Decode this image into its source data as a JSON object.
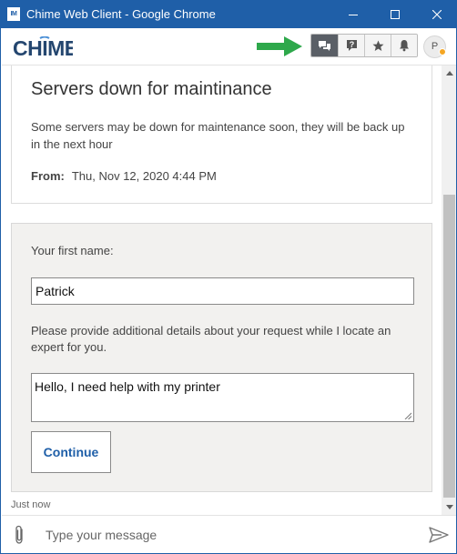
{
  "window": {
    "title": "Chime Web Client - Google Chrome",
    "app_icon_text": "IM"
  },
  "header": {
    "logo_text": "CHIME",
    "icons": [
      "chat-icon",
      "help-icon",
      "star-icon",
      "bell-icon"
    ],
    "avatar_initial": "P",
    "avatar_status_color": "#f5a623",
    "accent_color": "#1f5fa8",
    "pointer_arrow_color": "#2ea84b"
  },
  "notice": {
    "title": "Servers down for maintinance",
    "body": "Some servers may be down for maintenance soon, they will be back up in the next hour",
    "from_label": "From:",
    "from_value": "Thu, Nov 12, 2020 4:44 PM"
  },
  "form": {
    "first_name_label": "Your first name:",
    "first_name_value": "Patrick",
    "details_label": "Please provide additional details about your request while I locate an expert for you.",
    "details_value": "Hello, I need help with my printer",
    "continue_label": "Continue"
  },
  "timestamp": "Just now",
  "composer": {
    "placeholder": "Type your message"
  }
}
